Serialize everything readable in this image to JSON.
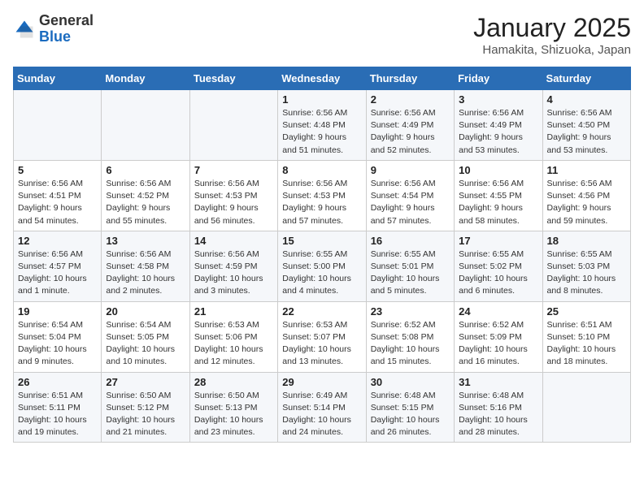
{
  "header": {
    "logo": {
      "general": "General",
      "blue": "Blue"
    },
    "title": "January 2025",
    "subtitle": "Hamakita, Shizuoka, Japan"
  },
  "weekdays": [
    "Sunday",
    "Monday",
    "Tuesday",
    "Wednesday",
    "Thursday",
    "Friday",
    "Saturday"
  ],
  "weeks": [
    [
      {
        "day": "",
        "info": ""
      },
      {
        "day": "",
        "info": ""
      },
      {
        "day": "",
        "info": ""
      },
      {
        "day": "1",
        "info": "Sunrise: 6:56 AM\nSunset: 4:48 PM\nDaylight: 9 hours\nand 51 minutes."
      },
      {
        "day": "2",
        "info": "Sunrise: 6:56 AM\nSunset: 4:49 PM\nDaylight: 9 hours\nand 52 minutes."
      },
      {
        "day": "3",
        "info": "Sunrise: 6:56 AM\nSunset: 4:49 PM\nDaylight: 9 hours\nand 53 minutes."
      },
      {
        "day": "4",
        "info": "Sunrise: 6:56 AM\nSunset: 4:50 PM\nDaylight: 9 hours\nand 53 minutes."
      }
    ],
    [
      {
        "day": "5",
        "info": "Sunrise: 6:56 AM\nSunset: 4:51 PM\nDaylight: 9 hours\nand 54 minutes."
      },
      {
        "day": "6",
        "info": "Sunrise: 6:56 AM\nSunset: 4:52 PM\nDaylight: 9 hours\nand 55 minutes."
      },
      {
        "day": "7",
        "info": "Sunrise: 6:56 AM\nSunset: 4:53 PM\nDaylight: 9 hours\nand 56 minutes."
      },
      {
        "day": "8",
        "info": "Sunrise: 6:56 AM\nSunset: 4:53 PM\nDaylight: 9 hours\nand 57 minutes."
      },
      {
        "day": "9",
        "info": "Sunrise: 6:56 AM\nSunset: 4:54 PM\nDaylight: 9 hours\nand 57 minutes."
      },
      {
        "day": "10",
        "info": "Sunrise: 6:56 AM\nSunset: 4:55 PM\nDaylight: 9 hours\nand 58 minutes."
      },
      {
        "day": "11",
        "info": "Sunrise: 6:56 AM\nSunset: 4:56 PM\nDaylight: 9 hours\nand 59 minutes."
      }
    ],
    [
      {
        "day": "12",
        "info": "Sunrise: 6:56 AM\nSunset: 4:57 PM\nDaylight: 10 hours\nand 1 minute."
      },
      {
        "day": "13",
        "info": "Sunrise: 6:56 AM\nSunset: 4:58 PM\nDaylight: 10 hours\nand 2 minutes."
      },
      {
        "day": "14",
        "info": "Sunrise: 6:56 AM\nSunset: 4:59 PM\nDaylight: 10 hours\nand 3 minutes."
      },
      {
        "day": "15",
        "info": "Sunrise: 6:55 AM\nSunset: 5:00 PM\nDaylight: 10 hours\nand 4 minutes."
      },
      {
        "day": "16",
        "info": "Sunrise: 6:55 AM\nSunset: 5:01 PM\nDaylight: 10 hours\nand 5 minutes."
      },
      {
        "day": "17",
        "info": "Sunrise: 6:55 AM\nSunset: 5:02 PM\nDaylight: 10 hours\nand 6 minutes."
      },
      {
        "day": "18",
        "info": "Sunrise: 6:55 AM\nSunset: 5:03 PM\nDaylight: 10 hours\nand 8 minutes."
      }
    ],
    [
      {
        "day": "19",
        "info": "Sunrise: 6:54 AM\nSunset: 5:04 PM\nDaylight: 10 hours\nand 9 minutes."
      },
      {
        "day": "20",
        "info": "Sunrise: 6:54 AM\nSunset: 5:05 PM\nDaylight: 10 hours\nand 10 minutes."
      },
      {
        "day": "21",
        "info": "Sunrise: 6:53 AM\nSunset: 5:06 PM\nDaylight: 10 hours\nand 12 minutes."
      },
      {
        "day": "22",
        "info": "Sunrise: 6:53 AM\nSunset: 5:07 PM\nDaylight: 10 hours\nand 13 minutes."
      },
      {
        "day": "23",
        "info": "Sunrise: 6:52 AM\nSunset: 5:08 PM\nDaylight: 10 hours\nand 15 minutes."
      },
      {
        "day": "24",
        "info": "Sunrise: 6:52 AM\nSunset: 5:09 PM\nDaylight: 10 hours\nand 16 minutes."
      },
      {
        "day": "25",
        "info": "Sunrise: 6:51 AM\nSunset: 5:10 PM\nDaylight: 10 hours\nand 18 minutes."
      }
    ],
    [
      {
        "day": "26",
        "info": "Sunrise: 6:51 AM\nSunset: 5:11 PM\nDaylight: 10 hours\nand 19 minutes."
      },
      {
        "day": "27",
        "info": "Sunrise: 6:50 AM\nSunset: 5:12 PM\nDaylight: 10 hours\nand 21 minutes."
      },
      {
        "day": "28",
        "info": "Sunrise: 6:50 AM\nSunset: 5:13 PM\nDaylight: 10 hours\nand 23 minutes."
      },
      {
        "day": "29",
        "info": "Sunrise: 6:49 AM\nSunset: 5:14 PM\nDaylight: 10 hours\nand 24 minutes."
      },
      {
        "day": "30",
        "info": "Sunrise: 6:48 AM\nSunset: 5:15 PM\nDaylight: 10 hours\nand 26 minutes."
      },
      {
        "day": "31",
        "info": "Sunrise: 6:48 AM\nSunset: 5:16 PM\nDaylight: 10 hours\nand 28 minutes."
      },
      {
        "day": "",
        "info": ""
      }
    ]
  ]
}
